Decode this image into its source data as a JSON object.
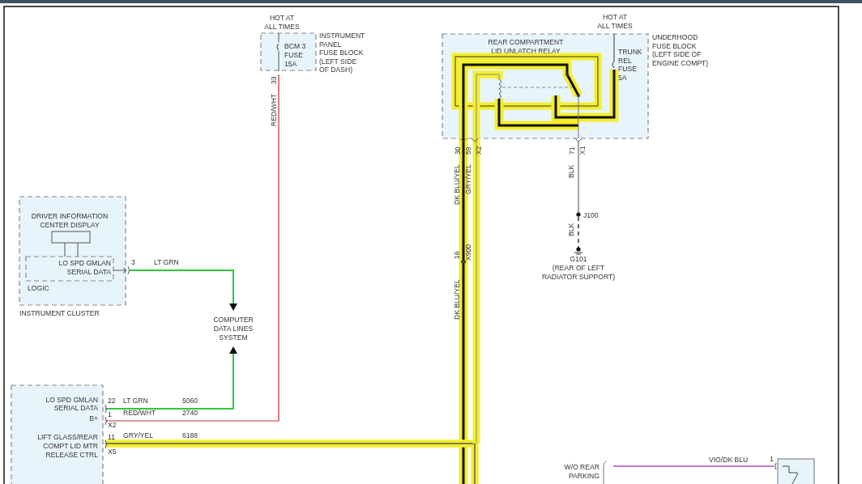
{
  "fuse_blocks": [
    {
      "heading": [
        "HOT AT",
        "ALL TIMES"
      ],
      "fuse": [
        "BCM 3",
        "FUSE",
        "15A"
      ],
      "location": [
        "INSTRUMENT",
        "PANEL",
        "FUSE BLOCK",
        "(LEFT SIDE",
        "OF DASH)"
      ]
    },
    {
      "heading": [
        "HOT AT",
        "ALL TIMES"
      ],
      "fuse": [
        "TRUNK",
        "REL",
        "FUSE",
        "5A"
      ],
      "location": [
        "UNDERHOOD",
        "FUSE BLOCK",
        "(LEFT SIDE OF",
        "ENGINE COMPT)"
      ]
    }
  ],
  "relay": {
    "name": [
      "REAR COMPARTMENT",
      "LID UNLATCH RELAY"
    ],
    "pins": [
      "30",
      "59",
      "X2"
    ],
    "ground_pins": [
      "71",
      "X1"
    ]
  },
  "fuse_wire": {
    "pin": "33",
    "color_code": "RED/WHT"
  },
  "instrument_cluster": {
    "display": [
      "DRIVER INFORMATION",
      "CENTER DISPLAY"
    ],
    "signal": [
      "LO SPD GMLAN",
      "SERIAL DATA"
    ],
    "logic": "LOGIC",
    "name": "INSTRUMENT CLUSTER",
    "pin": "3",
    "wire": "LT GRN"
  },
  "data_lines": [
    "COMPUTER",
    "DATA LINES",
    "SYSTEM"
  ],
  "vertical_wires": {
    "upper_left": "DK BLU/YEL",
    "upper_right": "GRY/YEL",
    "splice_pin": "16",
    "splice": "X900",
    "lower_left": "DK BLU/YEL"
  },
  "ground": {
    "wire_upper": "BLK",
    "junction": "J100",
    "wire_lower": "BLK",
    "name": "G101",
    "location": [
      "(REAR OF LEFT",
      "RADIATOR SUPPORT)"
    ]
  },
  "body_module": {
    "circuits": [
      {
        "label": [
          "LO SPD GMLAN",
          "SERIAL DATA"
        ],
        "pin": "22",
        "wire": "LT GRN",
        "circuit": "5060"
      },
      {
        "label": [
          "B+"
        ],
        "pin": "1",
        "wire": "RED/WHT",
        "circuit": "2740"
      },
      {
        "label": [
          "LIFT GLASS/REAR",
          "COMPT LID MTR",
          "RELEASE CTRL"
        ],
        "pin": "11",
        "wire": "GRY/YEL",
        "circuit": "6188"
      }
    ],
    "connectors": [
      "X2",
      "X5"
    ]
  },
  "parking_assist": {
    "option": [
      "W/O REAR",
      "PARKING"
    ],
    "wire": "VIO/DK BLU",
    "pin": "1"
  }
}
